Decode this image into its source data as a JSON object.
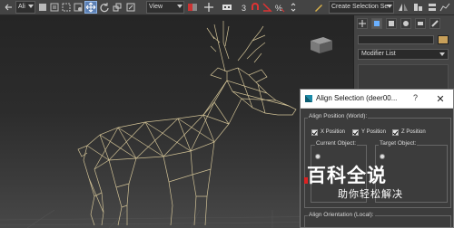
{
  "toolbar": {
    "selection_filter": "Ali",
    "reference_coord_system": "View",
    "named_selection_set": "Create Selection Se",
    "icons": [
      "undo-icon",
      "object-select-icon",
      "select-by-name-icon",
      "rectangle-region-icon",
      "window-crossing-icon",
      "select-move-icon",
      "select-rotate-icon",
      "select-scale-icon",
      "pivot-center-icon",
      "select-manipulate-icon",
      "keyboard-shortcut-icon",
      "snap-toggle-icon",
      "angle-snap-icon",
      "percent-snap-icon",
      "spinner-snap-icon",
      "edit-named-sets-icon",
      "mirror-icon",
      "align-icon"
    ]
  },
  "command_panel": {
    "modifier_list": "Modifier List",
    "tabs": [
      "create-tab",
      "modify-tab",
      "hierarchy-tab",
      "motion-tab",
      "display-tab",
      "utilities-tab"
    ]
  },
  "align_dialog": {
    "title": "Align Selection (deer00...",
    "help": "?",
    "close": "✕",
    "position_group": "Align Position (World):",
    "x_position": "X Position",
    "y_position": "Y Position",
    "z_position": "Z Position",
    "current_object": "Current Object:",
    "target_object": "Target Object:",
    "orientation_group": "Align Orientation (Local):"
  },
  "watermark": {
    "title": "百科全说",
    "subtitle": "助你轻松解决"
  },
  "colors": {
    "wireframe": "#d8c89a",
    "dialog_titlebar": "#ffffff",
    "dialog_body": "#3c3c3c",
    "toolbar": "#444444"
  }
}
